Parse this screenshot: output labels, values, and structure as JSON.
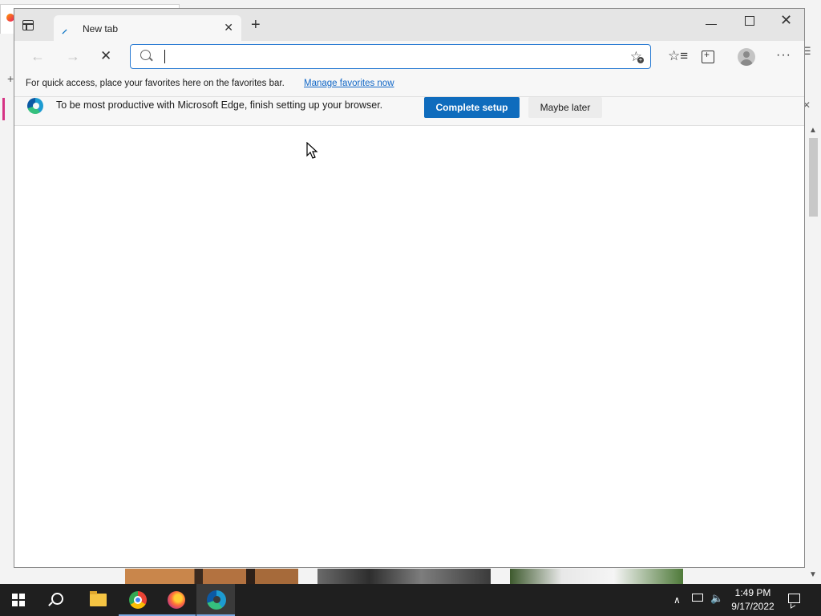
{
  "browser": {
    "tab_title": "New tab",
    "tab_favicon": "loading-favicon-icon",
    "address_bar": {
      "value": "",
      "placeholder": ""
    }
  },
  "favorites_bar": {
    "text": "For quick access, place your favorites here on the favorites bar.",
    "link": "Manage favorites now"
  },
  "setup_banner": {
    "text": "To be most productive with Microsoft Edge, finish setting up your browser.",
    "primary_button": "Complete setup",
    "secondary_button": "Maybe later"
  },
  "toolbar_icons": [
    "back-icon",
    "forward-icon",
    "stop-icon",
    "search-icon",
    "add-favorite-icon",
    "favorites-icon",
    "collections-icon",
    "profile-icon",
    "more-icon"
  ],
  "taskbar": {
    "apps": [
      "windows-start-icon",
      "search-icon",
      "file-explorer-icon",
      "chrome-icon",
      "firefox-icon",
      "edge-icon"
    ],
    "clock": {
      "time": "1:49 PM",
      "date": "9/17/2022"
    }
  },
  "colors": {
    "accent": "#0f6cbd",
    "link": "#1167c7",
    "taskbar": "#1f1f1f",
    "address_border": "#2b7cd3"
  }
}
